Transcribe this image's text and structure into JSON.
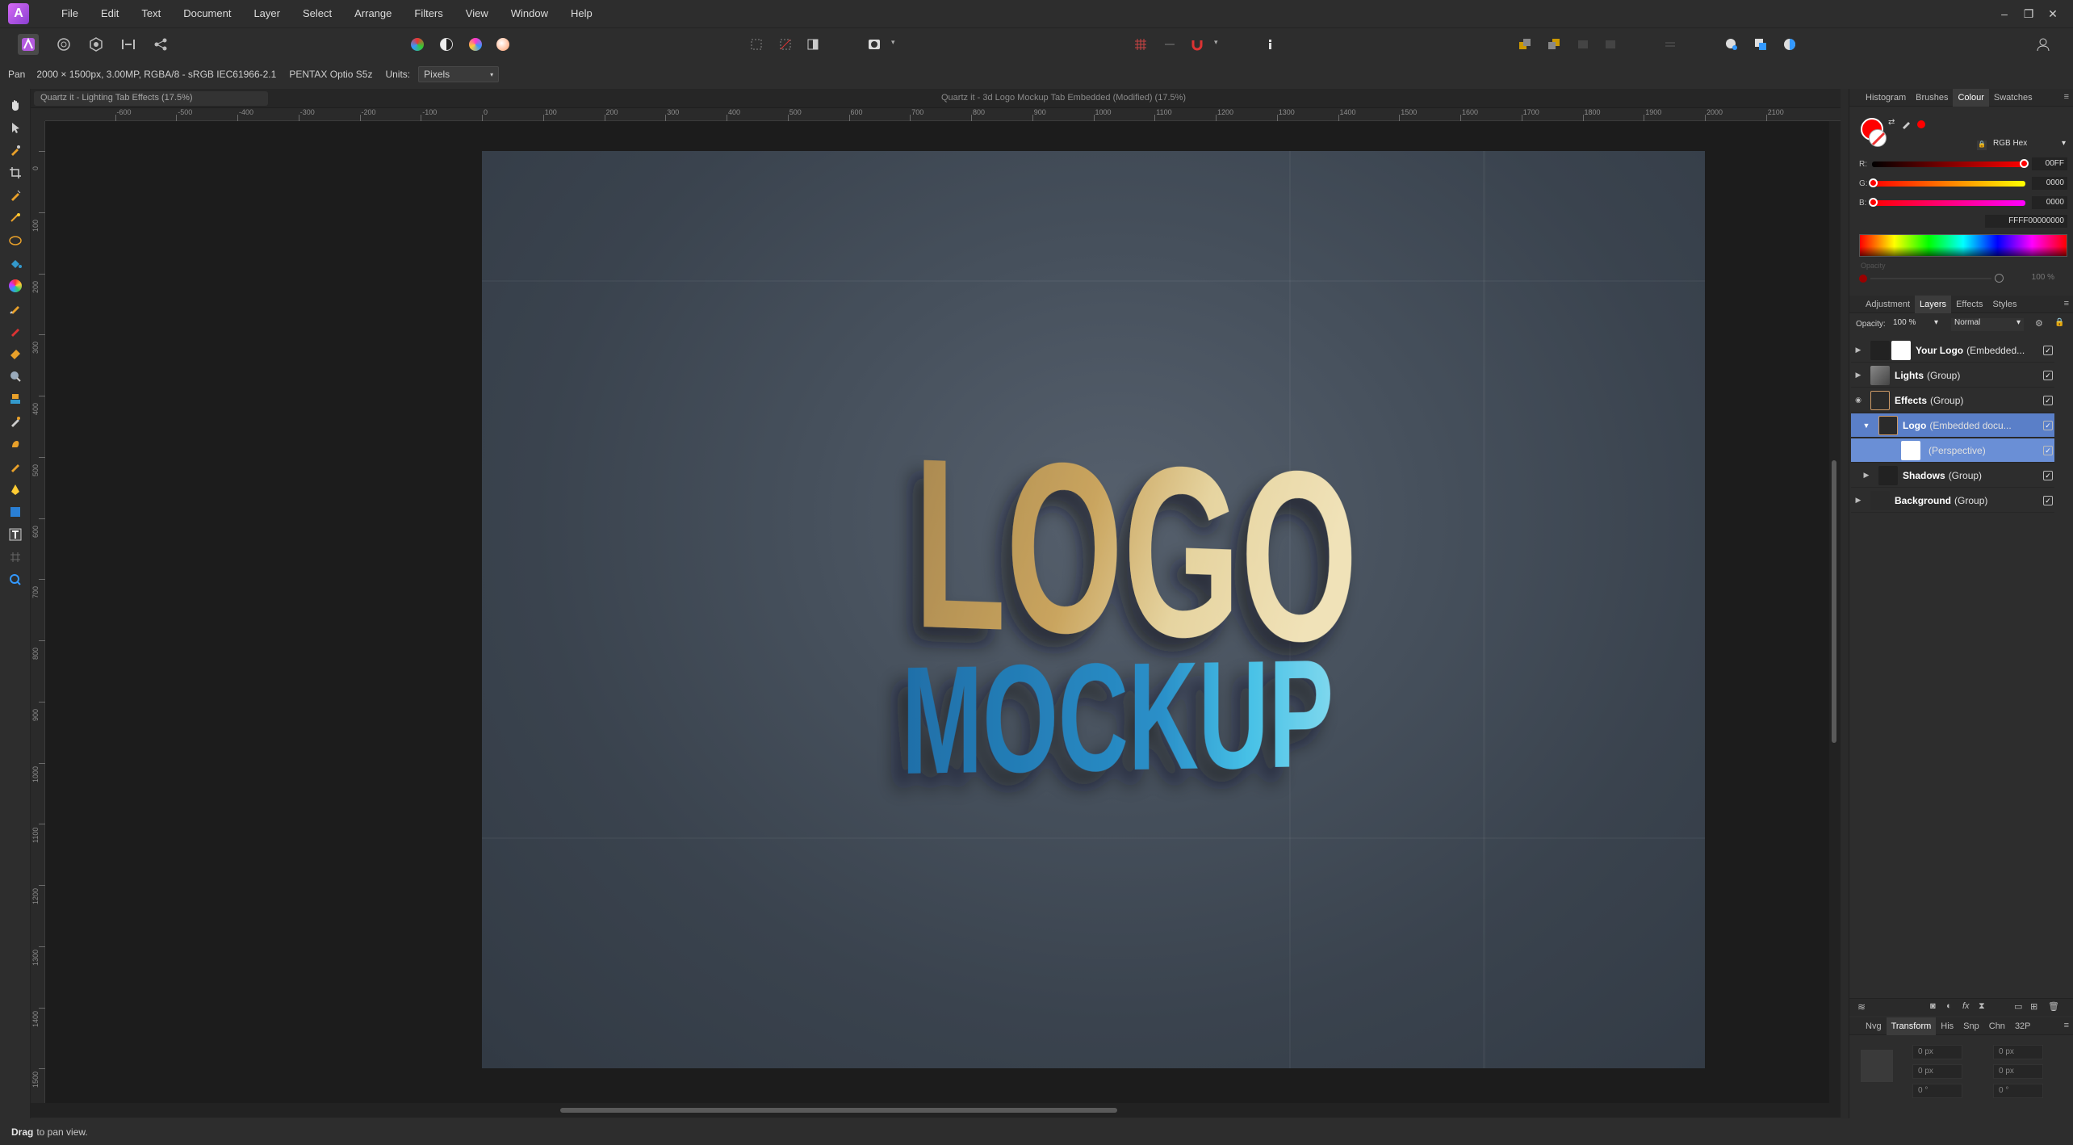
{
  "app": {
    "menu": [
      "File",
      "Edit",
      "Text",
      "Document",
      "Layer",
      "Select",
      "Arrange",
      "Filters",
      "View",
      "Window",
      "Help"
    ],
    "window_controls": [
      "–",
      "❐",
      "✕"
    ]
  },
  "context_bar": {
    "tool": "Pan",
    "doc_info": "2000 × 1500px, 3.00MP, RGBA/8 - sRGB IEC61966-2.1",
    "camera": "PENTAX Optio S5z",
    "units_label": "Units:",
    "units_value": "Pixels"
  },
  "document": {
    "tab_title_active": "Quartz it - Lighting Tab Effects (17.5%)",
    "tab_title_other": "Quartz it - 3d Logo Mockup Tab Embedded (Modified) (17.5%)",
    "logo_line1": "LOGO",
    "logo_line2": "MOCKUP"
  },
  "rulers": {
    "h_ticks": [
      "-600",
      "-500",
      "-400",
      "-300",
      "-200",
      "-100",
      "0",
      "100",
      "200",
      "300",
      "400",
      "500",
      "600",
      "700",
      "800",
      "900",
      "1000",
      "1100",
      "1200",
      "1300",
      "1400",
      "1500",
      "1600",
      "1700",
      "1800",
      "1900",
      "2000",
      "2100"
    ],
    "v_ticks": [
      "0",
      "100",
      "200",
      "300",
      "400",
      "500",
      "600",
      "700",
      "800",
      "900",
      "1000",
      "1100",
      "1200",
      "1300",
      "1400",
      "1500"
    ]
  },
  "colour_panel": {
    "tabs": [
      "Histogram",
      "Brushes",
      "Colour",
      "Swatches"
    ],
    "active_tab": "Colour",
    "mode": "RGB Hex",
    "r_label": "R:",
    "r_value": "00FF",
    "g_label": "G:",
    "g_value": "0000",
    "b_label": "B:",
    "b_value": "0000",
    "hex_value": "FFFF00000000",
    "opacity_label": "Opacity",
    "opacity_value": "100 %",
    "primary_color": "#ff0000"
  },
  "layers_panel": {
    "tabs": [
      "Adjustment",
      "Layers",
      "Effects",
      "Styles"
    ],
    "active_tab": "Layers",
    "opacity_label": "Opacity:",
    "opacity_value": "100 %",
    "blend_mode": "Normal",
    "layers": [
      {
        "name": "Your Logo",
        "type": "(Embedded...",
        "expander": "▶",
        "indent": 0
      },
      {
        "name": "Lights",
        "type": "(Group)",
        "expander": "▶",
        "indent": 0
      },
      {
        "name": "Effects",
        "type": "(Group)",
        "expander": "◉",
        "indent": 0
      },
      {
        "name": "Logo",
        "type": "(Embedded docu...",
        "expander": "▼",
        "indent": 1,
        "selected": true
      },
      {
        "name": "",
        "type": "(Perspective)",
        "expander": "",
        "indent": 2,
        "selected": true
      },
      {
        "name": "Shadows",
        "type": "(Group)",
        "expander": "▶",
        "indent": 1
      },
      {
        "name": "Background",
        "type": "(Group)",
        "expander": "▶",
        "indent": 0
      }
    ]
  },
  "transform_panel": {
    "tabs": [
      "Nvg",
      "Transform",
      "His",
      "Snp",
      "Chn",
      "32P"
    ],
    "active_tab": "Transform",
    "x_value": "0 px",
    "y_value": "0 px",
    "w_value": "0 px",
    "h_value": "0 px",
    "r_value": "0 °",
    "s_value": "0 °"
  },
  "status": {
    "bold": "Drag",
    "text": "to pan view."
  }
}
